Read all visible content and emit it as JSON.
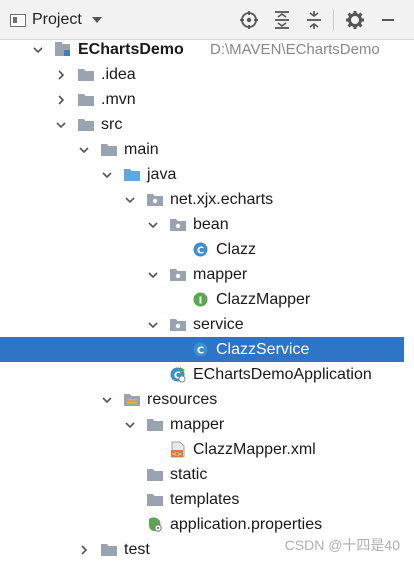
{
  "header": {
    "title": "Project",
    "icons": [
      "crosshair-icon",
      "expand-all-icon",
      "collapse-all-icon",
      "gear-icon",
      "minimize-icon"
    ]
  },
  "tree": [
    {
      "label": "EChartsDemo",
      "path": "D:\\MAVEN\\EChartsDemo",
      "bold": true,
      "level": 0,
      "expanded": true,
      "icon": "module-icon"
    },
    {
      "label": ".idea",
      "level": 1,
      "expanded": false,
      "icon": "folder-icon"
    },
    {
      "label": ".mvn",
      "level": 1,
      "expanded": false,
      "icon": "folder-icon"
    },
    {
      "label": "src",
      "level": 1,
      "expanded": true,
      "icon": "folder-icon"
    },
    {
      "label": "main",
      "level": 2,
      "expanded": true,
      "icon": "folder-icon"
    },
    {
      "label": "java",
      "level": 3,
      "expanded": true,
      "icon": "source-folder-icon"
    },
    {
      "label": "net.xjx.echarts",
      "level": 4,
      "expanded": true,
      "icon": "package-icon"
    },
    {
      "label": "bean",
      "level": 5,
      "expanded": true,
      "icon": "package-icon"
    },
    {
      "label": "Clazz",
      "level": 6,
      "icon": "class-icon",
      "letter": "C"
    },
    {
      "label": "mapper",
      "level": 5,
      "expanded": true,
      "icon": "package-icon"
    },
    {
      "label": "ClazzMapper",
      "level": 6,
      "icon": "interface-icon",
      "letter": "I"
    },
    {
      "label": "service",
      "level": 5,
      "expanded": true,
      "icon": "package-icon"
    },
    {
      "label": "ClazzService",
      "level": 6,
      "icon": "class-icon",
      "letter": "C",
      "selected": true
    },
    {
      "label": "EChartsDemoApplication",
      "level": 5,
      "icon": "spring-boot-app-icon",
      "letter": "C"
    },
    {
      "label": "resources",
      "level": 3,
      "expanded": true,
      "icon": "resources-folder-icon"
    },
    {
      "label": "mapper",
      "level": 4,
      "expanded": true,
      "icon": "folder-icon"
    },
    {
      "label": "ClazzMapper.xml",
      "level": 5,
      "icon": "xml-file-icon"
    },
    {
      "label": "static",
      "level": 4,
      "icon": "folder-icon"
    },
    {
      "label": "templates",
      "level": 4,
      "icon": "folder-icon"
    },
    {
      "label": "application.properties",
      "level": 4,
      "icon": "properties-file-icon"
    },
    {
      "label": "test",
      "level": 2,
      "expanded": false,
      "icon": "folder-icon"
    }
  ],
  "watermark": "CSDN @十四是40",
  "colors": {
    "selection": "#2f75c7",
    "folder": "#9aa4b0",
    "class": "#3a8fcf",
    "interface": "#5aa653",
    "spring": "#5aa653"
  }
}
